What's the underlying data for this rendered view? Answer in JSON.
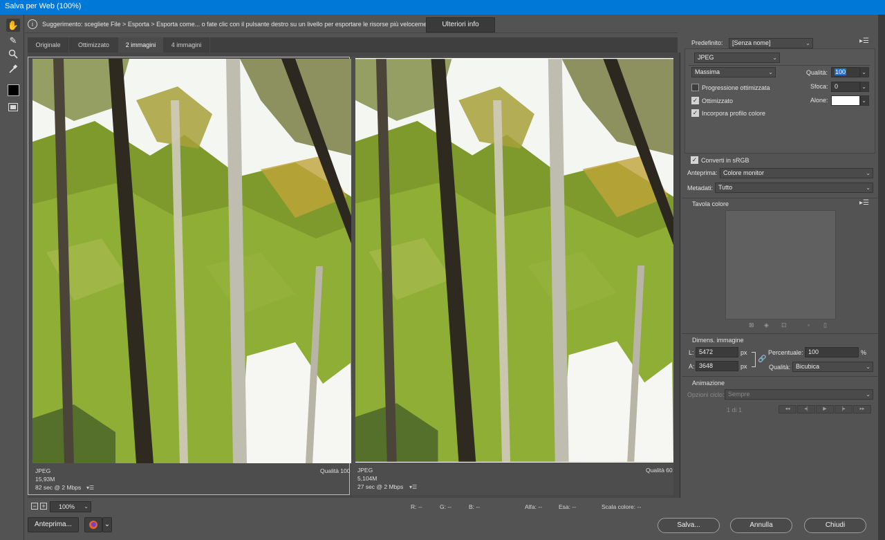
{
  "window": {
    "title": "Salva per Web (100%)"
  },
  "tools": [
    {
      "name": "hand-tool-icon",
      "glyph": "✋"
    },
    {
      "name": "slice-select-tool-icon",
      "glyph": "✎"
    },
    {
      "name": "zoom-tool-icon",
      "glyph": "🔍"
    },
    {
      "name": "eyedropper-tool-icon",
      "glyph": "✒"
    }
  ],
  "hint": {
    "icon": "i",
    "text": "Suggerimento: scegliete File > Esporta > Esporta come... o fate clic con il pulsante destro su un livello per esportare le risorse più velocemente",
    "button": "Ulteriori info"
  },
  "tabs": [
    "Originale",
    "Ottimizzato",
    "2 immagini",
    "4 immagini"
  ],
  "panes": [
    {
      "format": "JPEG",
      "size": "15,93M",
      "time": "82 sec @ 2 Mbps",
      "quality": "Qualità 100",
      "menu": "▾☰"
    },
    {
      "format": "JPEG",
      "size": "5,104M",
      "time": "27 sec @ 2 Mbps",
      "quality": "Qualità 60",
      "menu": "▾☰"
    }
  ],
  "status": {
    "zoom_minus": "−",
    "zoom_plus": "+",
    "zoom": "100%",
    "r": "R: --",
    "g": "G: --",
    "b": "B: --",
    "alpha": "Alfa: --",
    "hex": "Esa: --",
    "index": "Scala colore: --"
  },
  "buttons": {
    "preview": "Anteprima...",
    "save": "Salva...",
    "cancel": "Annulla",
    "close": "Chiudi"
  },
  "settings": {
    "preset_label": "Predefinito:",
    "preset_value": "[Senza nome]",
    "format": "JPEG",
    "quality_preset": "Massima",
    "quality_label": "Qualità:",
    "quality_value": "100",
    "progressive": "Progressione ottimizzata",
    "blur_label": "Sfoca:",
    "blur_value": "0",
    "optimized": "Ottimizzato",
    "matte_label": "Alone:",
    "embed_profile": "Incorpora profilo colore",
    "convert_srgb": "Converti in sRGB",
    "preview_label": "Anteprima:",
    "preview_value": "Colore monitor",
    "metadata_label": "Metadati:",
    "metadata_value": "Tutto",
    "checked": {
      "progressive": false,
      "optimized": true,
      "embed_profile": true,
      "convert_srgb": true
    }
  },
  "color_table": {
    "title": "Tavola colore"
  },
  "image_size": {
    "title": "Dimens. immagine",
    "w_label": "L:",
    "w_value": "5472",
    "w_unit": "px",
    "h_label": "A:",
    "h_value": "3648",
    "h_unit": "px",
    "percent_label": "Percentuale:",
    "percent_value": "100",
    "percent_unit": "%",
    "quality_label": "Qualità:",
    "quality_value": "Bicubica"
  },
  "animation": {
    "title": "Animazione",
    "loop_label": "Opzioni ciclo:",
    "loop_value": "Sempre",
    "frame": "1 di 1"
  },
  "colors": {
    "titlebar": "#0078d7",
    "panel": "#535353",
    "accent_select": "#1e6fd6"
  }
}
